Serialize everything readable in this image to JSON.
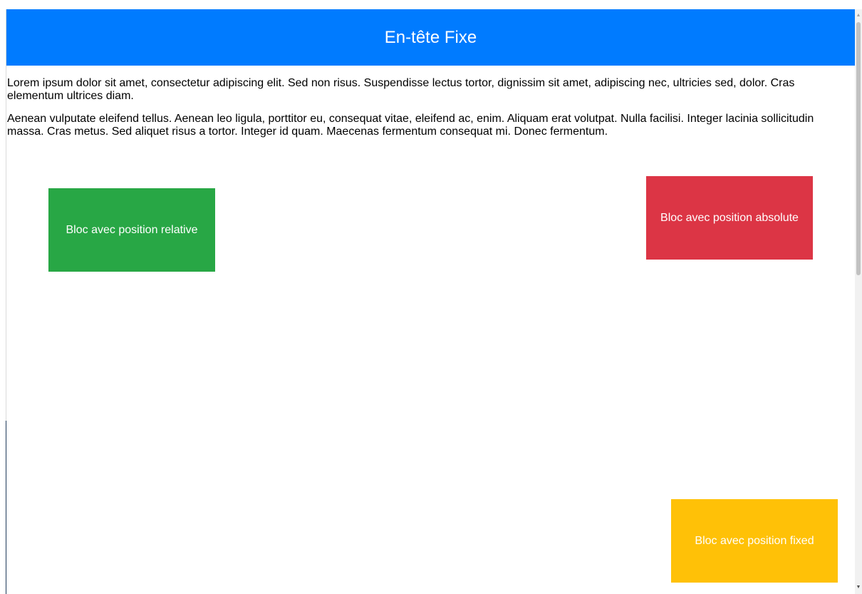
{
  "header": {
    "title": "En-tête Fixe",
    "background": "#007bff"
  },
  "content": {
    "paragraphs": [
      "Lorem ipsum dolor sit amet, consectetur adipiscing elit. Sed non risus. Suspendisse lectus tortor, dignissim sit amet, adipiscing nec, ultricies sed, dolor. Cras elementum ultrices diam.",
      "Aenean vulputate eleifend tellus. Aenean leo ligula, porttitor eu, consequat vitae, eleifend ac, enim. Aliquam erat volutpat. Nulla facilisi. Integer lacinia sollicitudin massa. Cras metus. Sed aliquet risus a tortor. Integer id quam. Maecenas fermentum consequat mi. Donec fermentum."
    ]
  },
  "boxes": {
    "relative": {
      "label": "Bloc avec position relative",
      "color": "#28a745"
    },
    "absolute": {
      "label": "Bloc avec position absolute",
      "color": "#dc3545"
    },
    "fixed": {
      "label": "Bloc avec position fixed",
      "color": "#ffc107"
    }
  },
  "scrollbar": {
    "up_icon": "scroll-up-arrow-icon",
    "down_icon": "scroll-down-arrow-icon"
  }
}
